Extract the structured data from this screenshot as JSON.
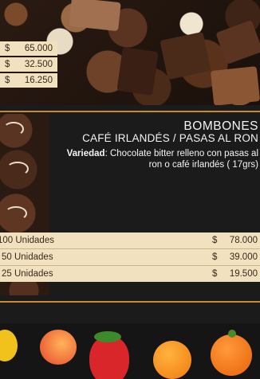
{
  "top_prices": [
    "65.000",
    "32.500",
    "16.250"
  ],
  "currency": "$",
  "product": {
    "category": "BOMBONES",
    "name": "CAFÉ IRLANDÉS / PASAS AL RON",
    "variety_label": "Variedad",
    "variety_text": ": Chocolate bitter relleno con pasas al ron o café irlandés ( 17grs)"
  },
  "table": [
    {
      "qty": "100 Unidades",
      "price": "78.000"
    },
    {
      "qty": "50 Unidades",
      "price": "39.000"
    },
    {
      "qty": "25 Unidades",
      "price": "19.500"
    }
  ],
  "colors": {
    "accent": "#c98a2c",
    "chip": "#f1e1bf",
    "background": "#1c1b1b"
  },
  "images": {
    "top": "chocolate-bonbons-photo",
    "middle": "truffles-photo",
    "bottom": "marzipan-fruits-photo"
  }
}
